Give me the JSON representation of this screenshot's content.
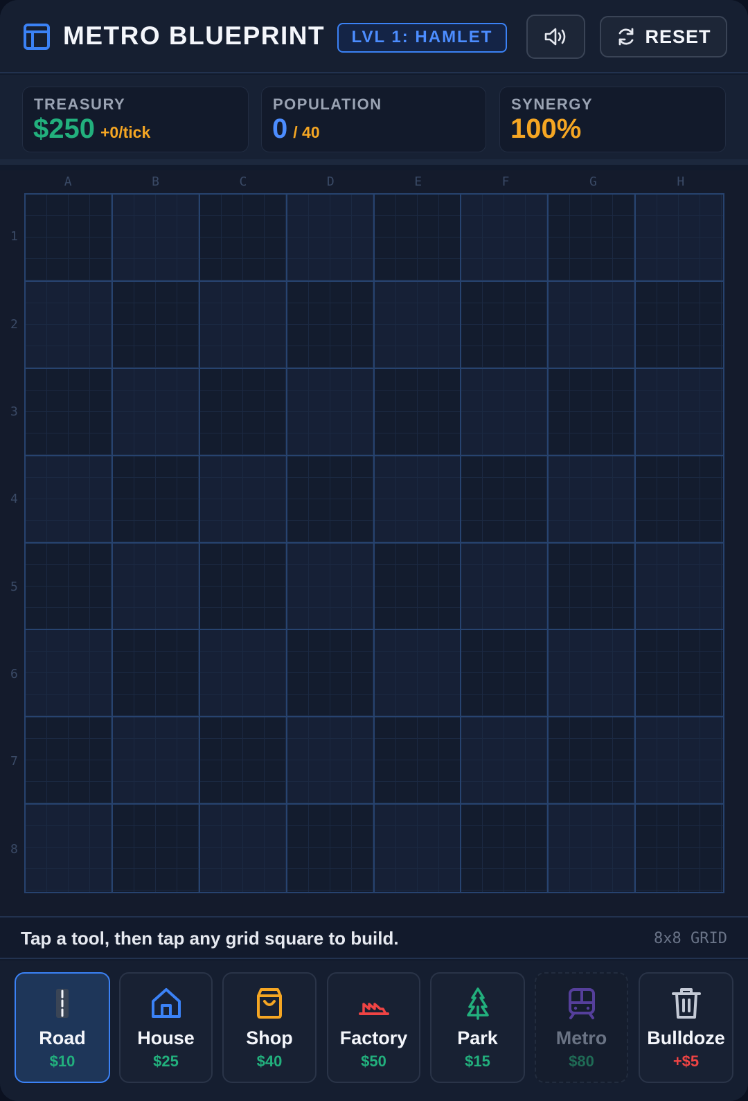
{
  "header": {
    "title": "METRO BLUEPRINT",
    "level": "LVL 1: HAMLET",
    "reset_label": "RESET",
    "accent": "#3b82f6"
  },
  "stats": {
    "treasury": {
      "label": "TREASURY",
      "value": "$250",
      "rate": "+0/tick",
      "color": "#22b07d"
    },
    "population": {
      "label": "POPULATION",
      "value": "0",
      "capacity": "/ 40",
      "color": "#4c8dff"
    },
    "synergy": {
      "label": "SYNERGY",
      "value": "100%",
      "color": "#f5a623"
    }
  },
  "board": {
    "columns": [
      "A",
      "B",
      "C",
      "D",
      "E",
      "F",
      "G",
      "H"
    ],
    "rows": [
      "1",
      "2",
      "3",
      "4",
      "5",
      "6",
      "7",
      "8"
    ]
  },
  "hint": {
    "text": "Tap a tool, then tap any grid square to build.",
    "grid_size": "8x8 GRID"
  },
  "tools": [
    {
      "name": "Road",
      "cost": "$10",
      "icon": "road-icon",
      "selected": true,
      "disabled": false
    },
    {
      "name": "House",
      "cost": "$25",
      "icon": "house-icon",
      "selected": false,
      "disabled": false
    },
    {
      "name": "Shop",
      "cost": "$40",
      "icon": "shopping-bag-icon",
      "selected": false,
      "disabled": false
    },
    {
      "name": "Factory",
      "cost": "$50",
      "icon": "factory-icon",
      "selected": false,
      "disabled": false
    },
    {
      "name": "Park",
      "cost": "$15",
      "icon": "tree-icon",
      "selected": false,
      "disabled": false
    },
    {
      "name": "Metro",
      "cost": "$80",
      "icon": "train-icon",
      "selected": false,
      "disabled": true
    },
    {
      "name": "Bulldoze",
      "cost": "+$5",
      "icon": "trash-icon",
      "selected": false,
      "disabled": false
    }
  ]
}
